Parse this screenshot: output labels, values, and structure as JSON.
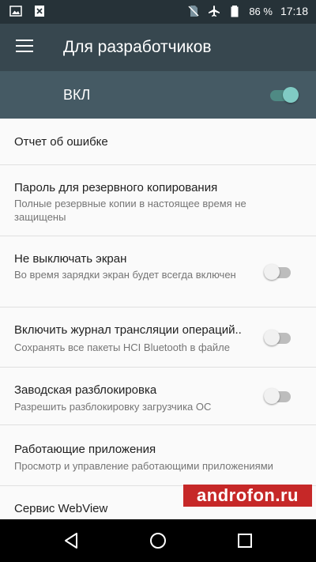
{
  "status_bar": {
    "battery": "86 %",
    "time": "17:18"
  },
  "app_bar": {
    "title": "Для разработчиков"
  },
  "master_switch": {
    "label": "ВКЛ",
    "on": true
  },
  "items": [
    {
      "title": "Отчет об ошибке",
      "subtitle": ""
    },
    {
      "title": "Пароль для резервного копирования",
      "subtitle": "Полные резервные копии в настоящее время не защищены"
    },
    {
      "title": "Не выключать экран",
      "subtitle": "Во время зарядки экран будет всегда включен",
      "toggle": false
    },
    {
      "title": "Включить журнал трансляции операций..",
      "subtitle": "Сохранять все пакеты HCI Bluetooth в файле",
      "toggle": false
    },
    {
      "title": "Заводская разблокировка",
      "subtitle": "Разрешить разблокировку загрузчика ОС",
      "toggle": false
    },
    {
      "title": "Работающие приложения",
      "subtitle": "Просмотр и управление работающими приложениями"
    },
    {
      "title": "Сервис WebView",
      "subtitle": ""
    }
  ],
  "watermark": "androfon.ru",
  "colors": {
    "status_bar": "#263238",
    "app_bar": "#37474f",
    "master_bar": "#455a64",
    "accent": "#80cbc4"
  },
  "icons": [
    "image-icon",
    "close-file-icon",
    "no-sim-icon",
    "airplane-icon",
    "battery-icon",
    "menu-icon",
    "back-icon",
    "home-icon",
    "recents-icon"
  ]
}
